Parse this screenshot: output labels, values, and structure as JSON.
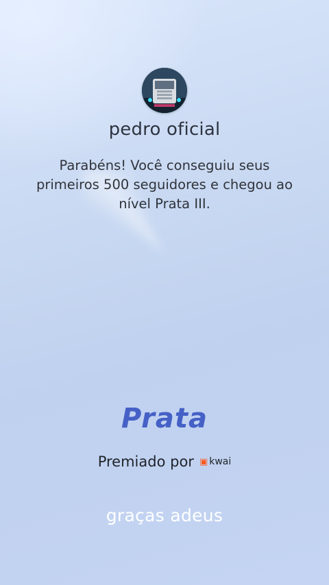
{
  "profile": {
    "username": "pedro oficial",
    "avatar_icon": "truck-avatar"
  },
  "achievement": {
    "message": "Parabéns! Você conseguiu seus primeiros 500 seguidores e chegou ao nível Prata III.",
    "tier": "Prata",
    "awarded_by_label": "Premiado por",
    "brand_name": "kwai",
    "brand_color": "#ff5a1f",
    "tier_color": "#4560c6"
  },
  "footer": {
    "caption": "graças adeus"
  }
}
